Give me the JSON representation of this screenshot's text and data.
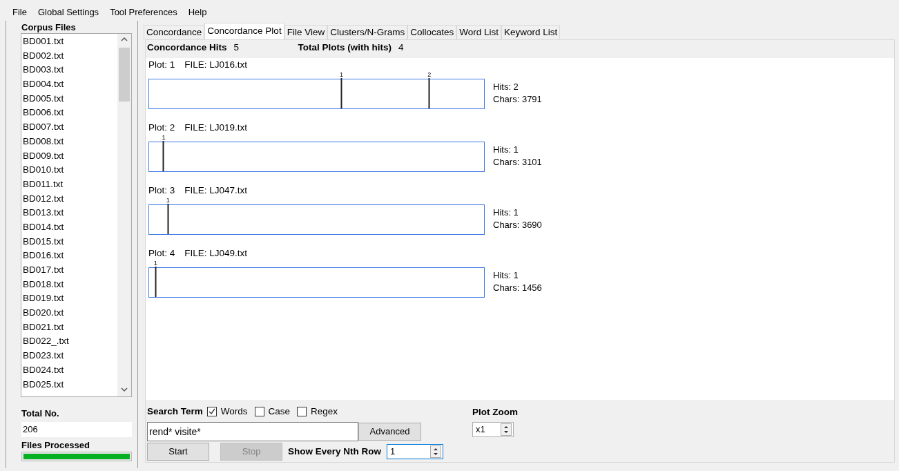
{
  "menu": [
    "File",
    "Global Settings",
    "Tool Preferences",
    "Help"
  ],
  "corpus": {
    "title": "Corpus Files",
    "files": [
      "BD001.txt",
      "BD002.txt",
      "BD003.txt",
      "BD004.txt",
      "BD005.txt",
      "BD006.txt",
      "BD007.txt",
      "BD008.txt",
      "BD009.txt",
      "BD010.txt",
      "BD011.txt",
      "BD012.txt",
      "BD013.txt",
      "BD014.txt",
      "BD015.txt",
      "BD016.txt",
      "BD017.txt",
      "BD018.txt",
      "BD019.txt",
      "BD020.txt",
      "BD021.txt",
      "BD022_.txt",
      "BD023.txt",
      "BD024.txt",
      "BD025.txt"
    ],
    "total_label": "Total No.",
    "total_value": "206",
    "processed_label": "Files Processed",
    "progress": {
      "level": 1
    }
  },
  "tabs": [
    {
      "label": "Concordance",
      "selected": false
    },
    {
      "label": "Concordance Plot",
      "selected": true
    },
    {
      "label": "File View",
      "selected": false
    },
    {
      "label": "Clusters/N-Grams",
      "selected": false
    },
    {
      "label": "Collocates",
      "selected": false
    },
    {
      "label": "Word List",
      "selected": false
    },
    {
      "label": "Keyword List",
      "selected": false
    }
  ],
  "summary": {
    "hits_label": "Concordance Hits",
    "hits_value": "5",
    "plots_label": "Total Plots (with hits)",
    "plots_value": "4"
  },
  "plots": [
    {
      "plot": "Plot: 1",
      "file": "FILE: LJ016.txt",
      "hits": "Hits: 2",
      "chars": "Chars: 3791",
      "marks": [
        {
          "label": "1",
          "level": 0.574
        },
        {
          "label": "2",
          "level": 0.835
        }
      ]
    },
    {
      "plot": "Plot: 2",
      "file": "FILE: LJ019.txt",
      "hits": "Hits: 1",
      "chars": "Chars: 3101",
      "marks": [
        {
          "label": "1",
          "level": 0.045
        }
      ]
    },
    {
      "plot": "Plot: 3",
      "file": "FILE: LJ047.txt",
      "hits": "Hits: 1",
      "chars": "Chars: 3690",
      "marks": [
        {
          "label": "1",
          "level": 0.058
        }
      ]
    },
    {
      "plot": "Plot: 4",
      "file": "FILE: LJ049.txt",
      "hits": "Hits: 1",
      "chars": "Chars: 1456",
      "marks": [
        {
          "label": "1",
          "level": 0.021
        }
      ]
    }
  ],
  "search": {
    "label": "Search Term",
    "options": [
      {
        "label": "Words",
        "checked": true
      },
      {
        "label": "Case",
        "checked": false
      },
      {
        "label": "Regex",
        "checked": false
      }
    ],
    "value": "rend* visite*",
    "advanced": "Advanced",
    "start": {
      "label": "Start",
      "disabled": false
    },
    "stop": {
      "label": "Stop",
      "disabled": true
    },
    "nth_label": "Show Every Nth Row",
    "nth_value": "1"
  },
  "zoom": {
    "label": "Plot Zoom",
    "value": "x1"
  }
}
